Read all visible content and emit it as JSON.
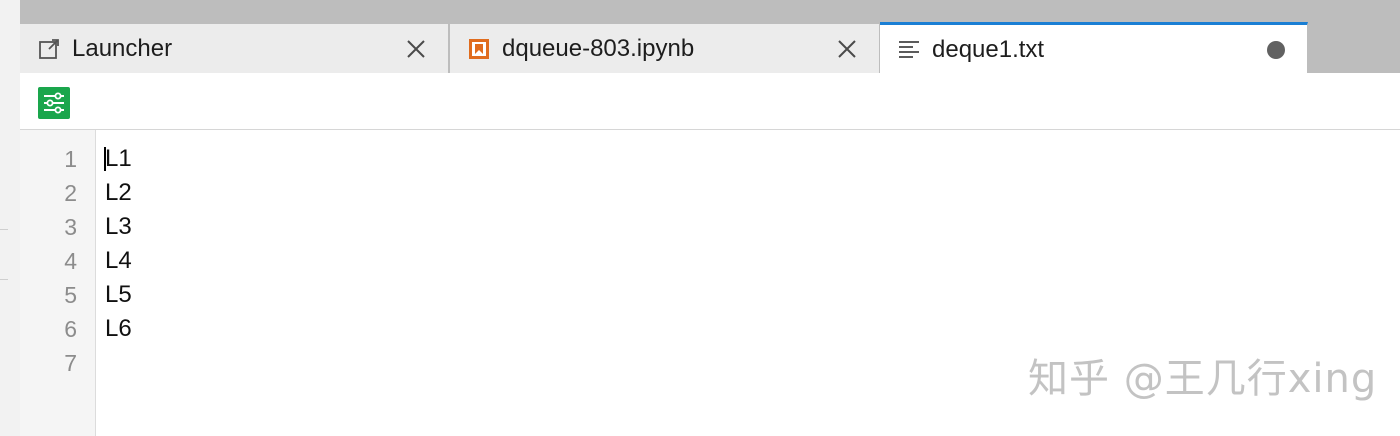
{
  "tabs": [
    {
      "label": "Launcher",
      "icon": "launcher-icon",
      "active": false,
      "close": "✕"
    },
    {
      "label": "dqueue-803.ipynb",
      "icon": "notebook-icon",
      "active": false,
      "close": "✕"
    },
    {
      "label": "deque1.txt",
      "icon": "text-file-icon",
      "active": true,
      "dirty": true
    }
  ],
  "toolbar": {
    "settings_icon": "settings-icon"
  },
  "editor": {
    "line_numbers": [
      "1",
      "2",
      "3",
      "4",
      "5",
      "6",
      "7"
    ],
    "lines": [
      "L1",
      "L2",
      "L3",
      "L4",
      "L5",
      "L6",
      ""
    ]
  },
  "watermark": "知乎 @王几行xing",
  "colors": {
    "active_tab_accent": "#1a7fd4",
    "settings_button": "#1aa64c",
    "notebook_icon": "#e06c1e"
  }
}
